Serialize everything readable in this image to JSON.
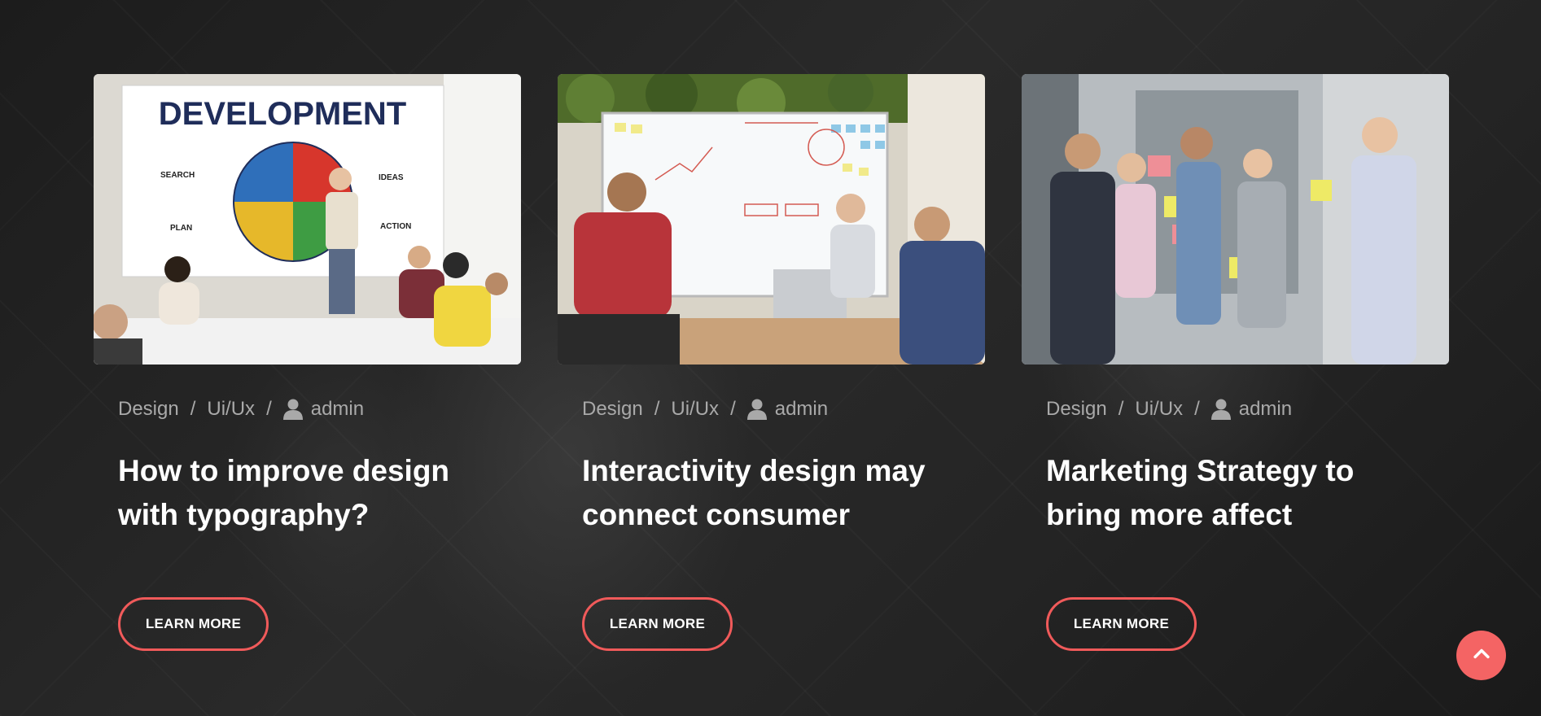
{
  "colors": {
    "accent": "#f05a5a",
    "background": "#232323",
    "meta_text": "#a9a9a9",
    "title_text": "#ffffff"
  },
  "posts": [
    {
      "image": {
        "description": "team meeting presentation",
        "board_title": "DEVELOPMENT",
        "board_labels": [
          "SEARCH",
          "IDEAS",
          "PLAN",
          "ACTION"
        ]
      },
      "category_1": "Design",
      "category_2": "Ui/Ux",
      "separator": "/",
      "author_icon": "user-icon",
      "author": "admin",
      "title": "How to improve design with typography?",
      "button_label": "LEARN MORE"
    },
    {
      "image": {
        "description": "team at whiteboard in office"
      },
      "category_1": "Design",
      "category_2": "Ui/Ux",
      "separator": "/",
      "author_icon": "user-icon",
      "author": "admin",
      "title": "Interactivity design may connect consumer",
      "button_label": "LEARN MORE"
    },
    {
      "image": {
        "description": "colleagues with sticky notes on glass wall"
      },
      "category_1": "Design",
      "category_2": "Ui/Ux",
      "separator": "/",
      "author_icon": "user-icon",
      "author": "admin",
      "title": "Marketing Strategy to bring more affect",
      "button_label": "LEARN MORE"
    }
  ],
  "scroll_top": {
    "icon": "chevron-up-icon"
  }
}
